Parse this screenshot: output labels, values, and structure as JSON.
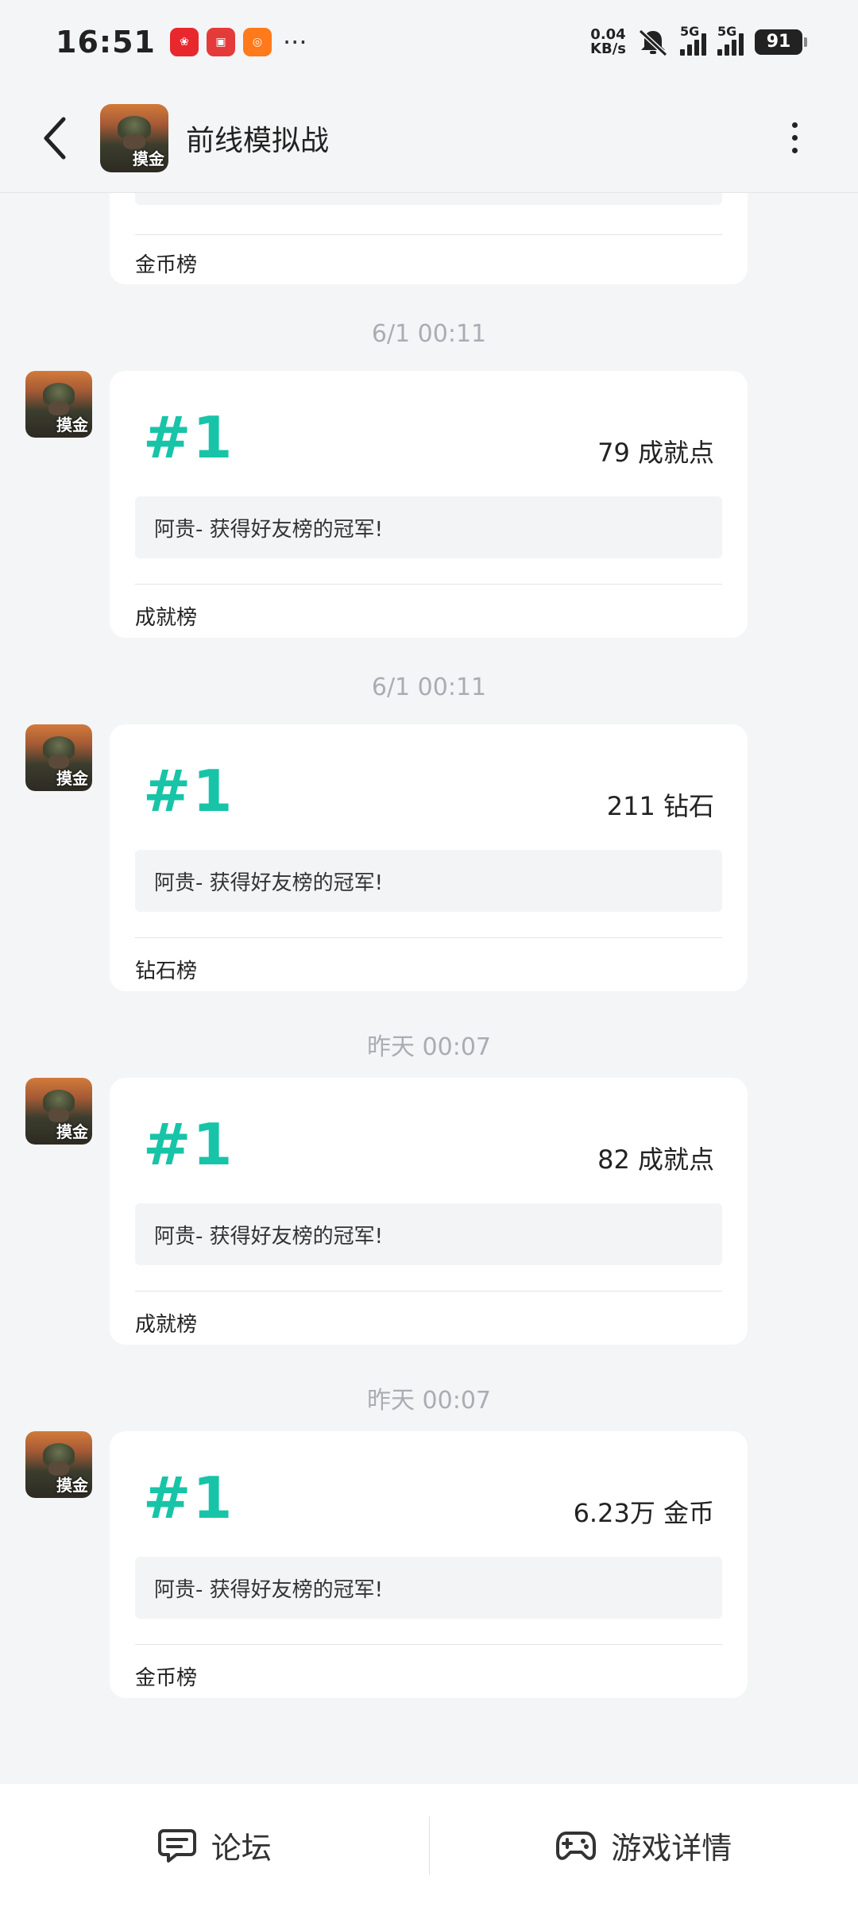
{
  "status_bar": {
    "time": "16:51",
    "net_speed_value": "0.04",
    "net_speed_unit": "KB/s",
    "sim1": "5G",
    "sim2": "5G",
    "battery": "91",
    "more": "···"
  },
  "header": {
    "title": "前线模拟战",
    "icon_tag": "摸金"
  },
  "partial_card": {
    "board": "金币榜"
  },
  "feed": [
    {
      "timestamp": "6/1  00:11",
      "rank": "#1",
      "score": "79 成就点",
      "message": "阿贵- 获得好友榜的冠军!",
      "board": "成就榜"
    },
    {
      "timestamp": "6/1  00:11",
      "rank": "#1",
      "score": "211 钻石",
      "message": "阿贵- 获得好友榜的冠军!",
      "board": "钻石榜"
    },
    {
      "timestamp": "昨天  00:07",
      "rank": "#1",
      "score": "82 成就点",
      "message": "阿贵- 获得好友榜的冠军!",
      "board": "成就榜"
    },
    {
      "timestamp": "昨天  00:07",
      "rank": "#1",
      "score": "6.23万 金币",
      "message": "阿贵- 获得好友榜的冠军!",
      "board": "金币榜"
    }
  ],
  "bottom_bar": {
    "forum_label": "论坛",
    "details_label": "游戏详情"
  },
  "colors": {
    "accent": "#18c4a7",
    "background": "#f4f5f7",
    "timestamp": "#a9adb3"
  },
  "icons": {
    "back": "chevron-left-icon",
    "menu": "more-vertical-icon",
    "forum": "chat-bubble-icon",
    "details": "gamepad-icon"
  }
}
